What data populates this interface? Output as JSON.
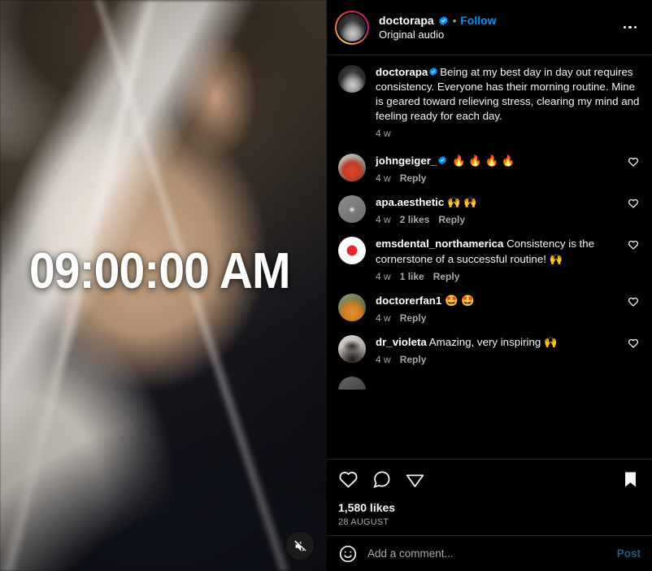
{
  "post": {
    "author": "doctorapa",
    "verified": true,
    "audio_label": "Original audio",
    "follow_label": "Follow",
    "separator": "•",
    "more_icon": "more-options-icon",
    "caption": "Being at my best day in day out requires consistency. Everyone has their morning routine. Mine is geared toward relieving stress, clearing my mind and feeling ready for each day.",
    "caption_time": "4 w",
    "likes_text": "1,580 likes",
    "date_text": "28 AUGUST"
  },
  "video": {
    "overlay_time": "09:00:00 AM",
    "mute_icon": "speaker-muted-icon"
  },
  "comments": [
    {
      "user": "johngeiger_",
      "verified": true,
      "text": "🔥 🔥 🔥 🔥",
      "time": "4 w",
      "likes": "",
      "reply": "Reply"
    },
    {
      "user": "apa.aesthetic",
      "verified": false,
      "text": "🙌 🙌",
      "time": "4 w",
      "likes": "2 likes",
      "reply": "Reply"
    },
    {
      "user": "emsdental_northamerica",
      "verified": false,
      "text": "Consistency is the cornerstone of a successful routine! 🙌",
      "time": "4 w",
      "likes": "1 like",
      "reply": "Reply"
    },
    {
      "user": "doctorerfan1",
      "verified": false,
      "text": "🤩 🤩",
      "time": "4 w",
      "likes": "",
      "reply": "Reply"
    },
    {
      "user": "dr_violeta",
      "verified": false,
      "text": "Amazing, very inspiring 🙌",
      "time": "4 w",
      "likes": "",
      "reply": "Reply"
    }
  ],
  "actions": {
    "like_icon": "heart-icon",
    "comment_icon": "comment-bubble-icon",
    "share_icon": "share-paper-plane-icon",
    "save_icon": "bookmark-filled-icon"
  },
  "add_comment": {
    "emoji_icon": "emoji-smiley-icon",
    "placeholder": "Add a comment...",
    "post_label": "Post"
  },
  "colors": {
    "accent_blue": "#0095f6",
    "post_blue": "#2a5a80",
    "background": "#000000",
    "divider": "#262626",
    "muted_text": "#a8a8a8"
  }
}
